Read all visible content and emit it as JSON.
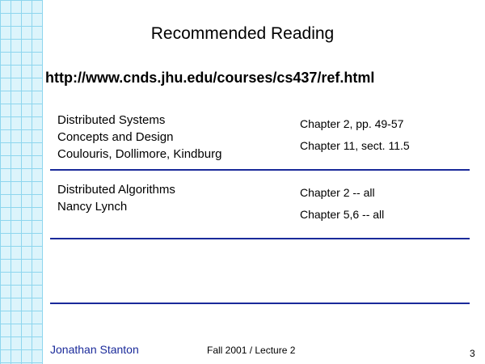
{
  "slide": {
    "title": "Recommended Reading",
    "url": "http://www.cnds.jhu.edu/courses/cs437/ref.html"
  },
  "books": [
    {
      "lines": [
        "Distributed Systems",
        "Concepts and Design",
        "Coulouris, Dollimore, Kindburg"
      ],
      "chapters": [
        "Chapter 2, pp. 49-57",
        "Chapter 11, sect. 11.5"
      ]
    },
    {
      "lines": [
        "Distributed Algorithms",
        "Nancy Lynch"
      ],
      "chapters": [
        "Chapter 2 -- all",
        "Chapter 5,6  -- all"
      ]
    }
  ],
  "footer": {
    "author": "Jonathan Stanton",
    "lecture": "Fall 2001 / Lecture 2",
    "page": "3"
  },
  "colors": {
    "grid_background": "#dcf4fb",
    "grid_lines": "#8ed6ee",
    "rule": "#1a2a9a",
    "author_text": "#1a2a9a"
  }
}
